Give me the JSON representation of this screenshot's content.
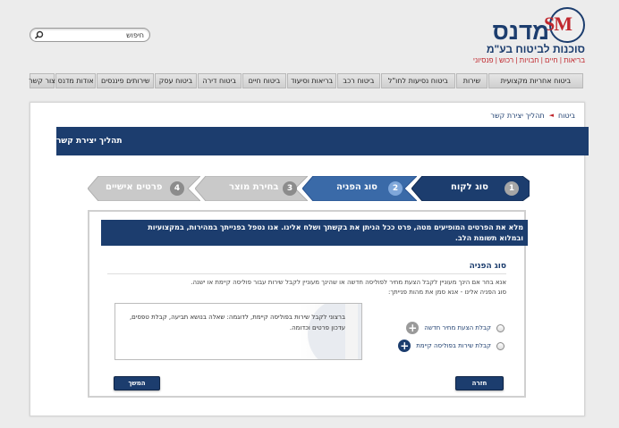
{
  "brand": {
    "logo_mark": "SM",
    "name": "מדנס",
    "tagline": "סוכנות לביטוח בע\"מ",
    "sub_tagline": "בריאות | חיים | חבויות | רכוש | פנסיוני"
  },
  "search": {
    "value": "חיפוש",
    "icon": "search-icon"
  },
  "nav": {
    "items": [
      "ביטוח אחריות מקצועית",
      "שירות",
      "ביטוח נסיעות לחו\"ל",
      "ביטוח רכב",
      "בריאות וסיעוד",
      "ביטוח חיים",
      "ביטוח דירה",
      "ביטוח עסק",
      "שירותים פיננסים",
      "אודות מדנס",
      "צור קשר"
    ]
  },
  "breadcrumb": {
    "home": "ביטוח",
    "current": "תהליך יצירת קשר",
    "separator": "◄"
  },
  "page": {
    "title": "תהליך יצירת קשר"
  },
  "steps": [
    {
      "number": "1",
      "label": "סוג לקוח",
      "state": "completed"
    },
    {
      "number": "2",
      "label": "סוג הפניה",
      "state": "active"
    },
    {
      "number": "3",
      "label": "בחירת מוצר",
      "state": "upcoming"
    },
    {
      "number": "4",
      "label": "פרטים אישיים",
      "state": "upcoming"
    }
  ],
  "notice": {
    "line1": "מלא את הפרטים המופיעים מטה, פרט ככל הניתן את בקשתך ושלח אלינו. אנו נטפל בפנייתך במהירות, במקצועיות",
    "line2": "ובמלוא תשומת הלב."
  },
  "section": {
    "title": "סוג הפניה",
    "desc_line1": "אנא בחר אם הינך מעוניין לקבל הצעת מחיר לפוליסה חדשה או שהינך מעוניין לקבל שירות עבור פוליסה קיימת או ישנה.",
    "desc_line2": "סוג הפניה אלינו - אנא סמן את מהות פנייתך:"
  },
  "options": [
    {
      "label": "קבלת הצעת מחיר חדשה",
      "icon": "plus-icon",
      "icon_color": "#9a9a9a"
    },
    {
      "label": "קבלת שירות בפוליסה קיימת",
      "icon": "plus-icon",
      "icon_color": "#1c3d6e"
    }
  ],
  "info_text": "ברצוני לקבל שירות בפוליסה קיימת, לדוגמה: שאלה בנושא תביעה, קבלת טפסים, עדכון פרטים וכדומה.",
  "buttons": {
    "back": "חזרה",
    "next": "המשך"
  },
  "colors": {
    "primary": "#1c3d6e",
    "accent": "#c0272d",
    "step_active": "#3a6aa8",
    "step_inactive": "#c8c8c8"
  }
}
